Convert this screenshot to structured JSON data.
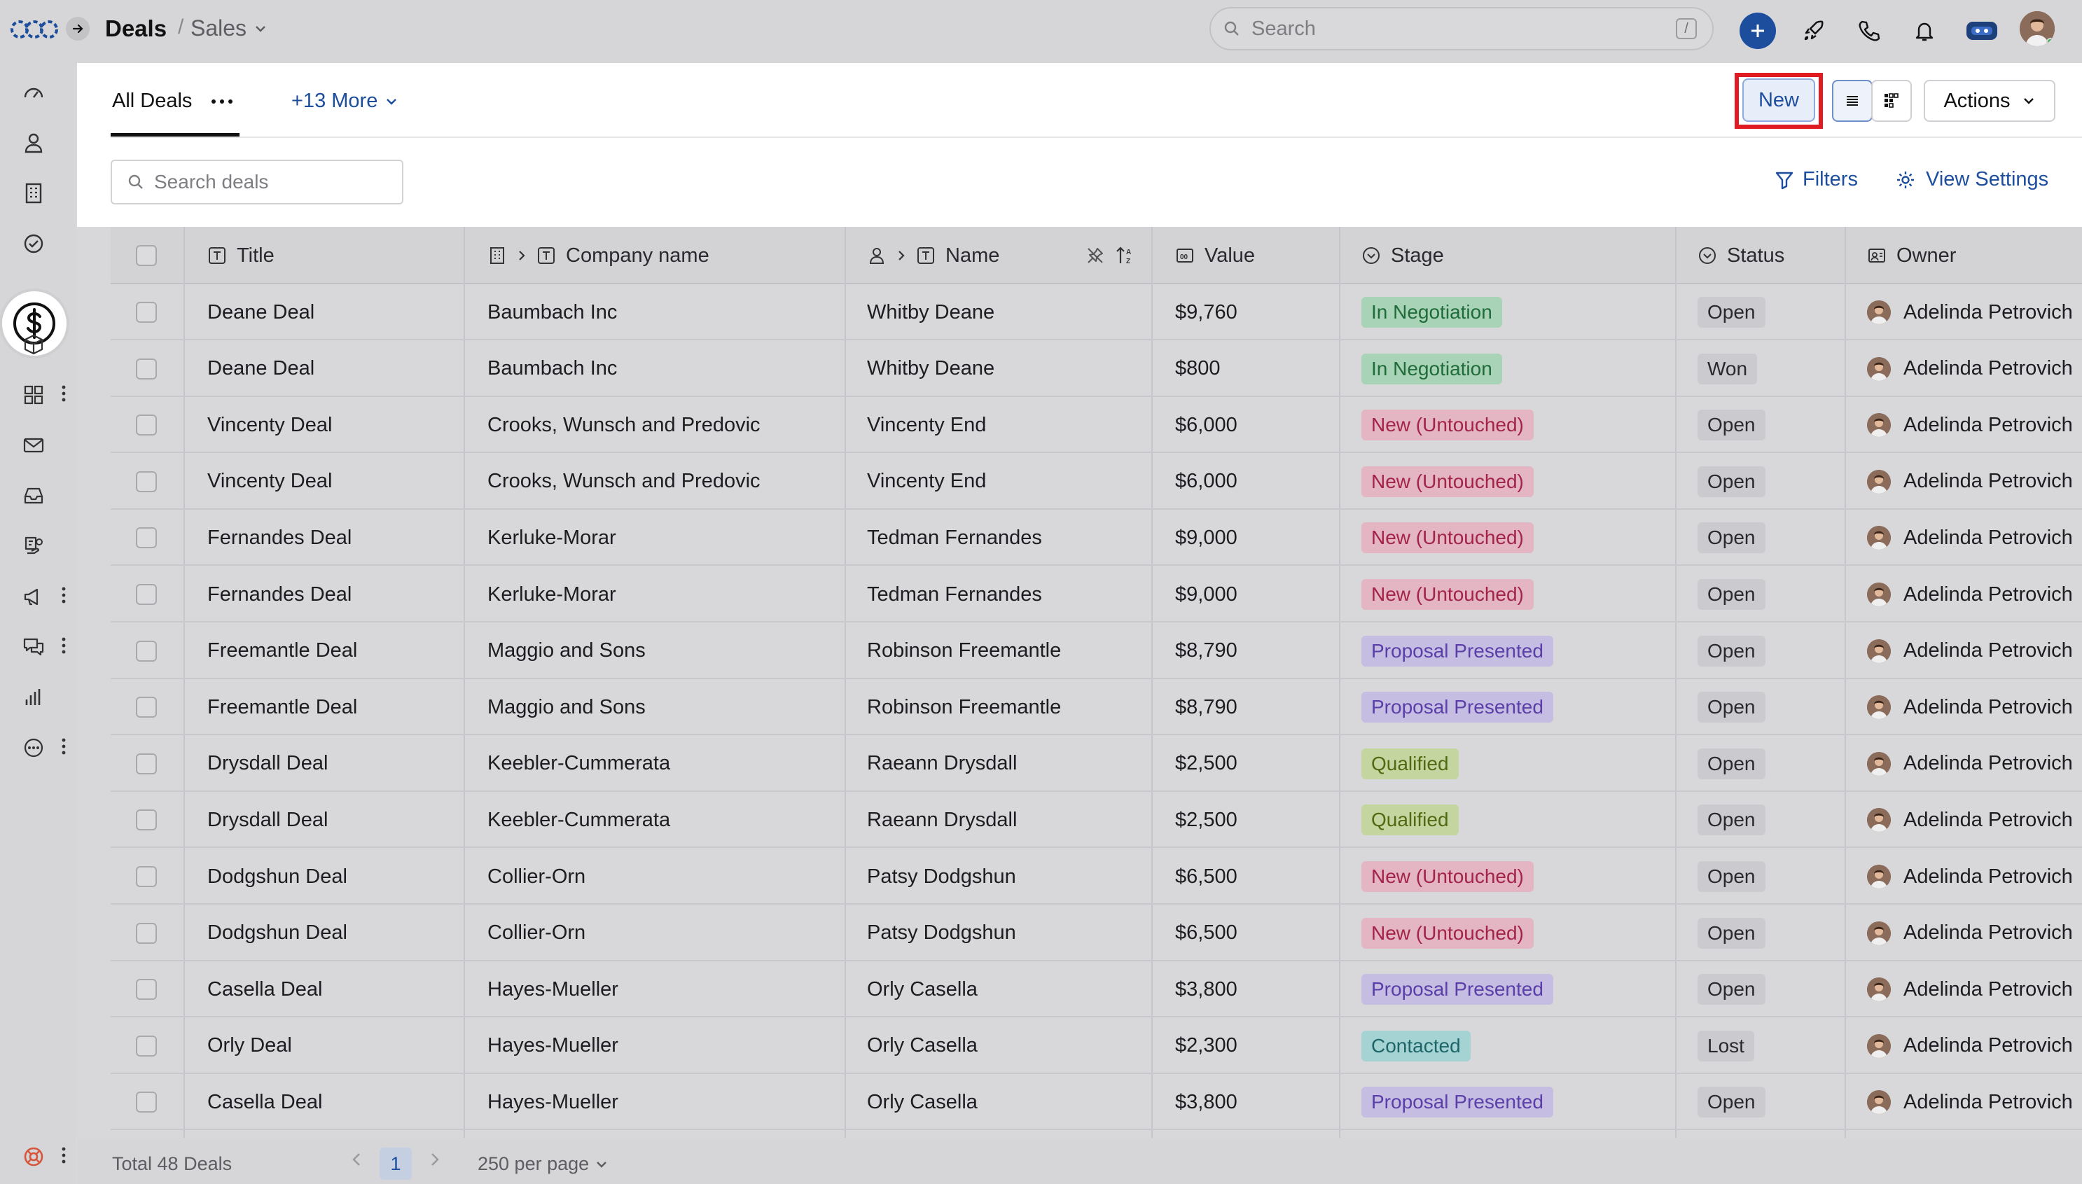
{
  "header": {
    "title": "Deals",
    "separator": "/",
    "subtitle": "Sales",
    "search_placeholder": "Search",
    "search_shortcut": "/"
  },
  "sidebar": {
    "items": [
      {
        "icon": "dashboard-icon"
      },
      {
        "icon": "person-icon"
      },
      {
        "icon": "building-icon"
      },
      {
        "icon": "check-circle-icon"
      },
      {
        "icon": "dollar-icon",
        "active": true
      },
      {
        "icon": "cube-icon"
      },
      {
        "icon": "apps-grid-icon"
      },
      {
        "icon": "mail-icon"
      },
      {
        "icon": "inbox-icon"
      },
      {
        "icon": "hand-coin-icon"
      },
      {
        "icon": "megaphone-icon"
      },
      {
        "icon": "chat-icon"
      },
      {
        "icon": "bar-chart-icon"
      },
      {
        "icon": "more-circle-icon"
      },
      {
        "icon": "help-buoy-icon"
      }
    ]
  },
  "tabs": {
    "active_label": "All Deals",
    "more_label": "+13 More"
  },
  "toolbar": {
    "new_label": "New",
    "actions_label": "Actions",
    "search_placeholder": "Search deals",
    "filters_label": "Filters",
    "view_settings_label": "View Settings"
  },
  "table": {
    "columns": {
      "title": "Title",
      "company": "Company name",
      "name": "Name",
      "value": "Value",
      "stage": "Stage",
      "status": "Status",
      "owner": "Owner"
    },
    "rows": [
      {
        "title": "Deane Deal",
        "company": "Baumbach Inc",
        "name": "Whitby Deane",
        "value": "$9,760",
        "stage": "In Negotiation",
        "status": "Open",
        "owner": "Adelinda Petrovich"
      },
      {
        "title": "Deane Deal",
        "company": "Baumbach Inc",
        "name": "Whitby Deane",
        "value": "$800",
        "stage": "In Negotiation",
        "status": "Won",
        "owner": "Adelinda Petrovich"
      },
      {
        "title": "Vincenty Deal",
        "company": "Crooks, Wunsch and Predovic",
        "name": "Vincenty End",
        "value": "$6,000",
        "stage": "New (Untouched)",
        "status": "Open",
        "owner": "Adelinda Petrovich"
      },
      {
        "title": "Vincenty Deal",
        "company": "Crooks, Wunsch and Predovic",
        "name": "Vincenty End",
        "value": "$6,000",
        "stage": "New (Untouched)",
        "status": "Open",
        "owner": "Adelinda Petrovich"
      },
      {
        "title": "Fernandes Deal",
        "company": "Kerluke-Morar",
        "name": "Tedman Fernandes",
        "value": "$9,000",
        "stage": "New (Untouched)",
        "status": "Open",
        "owner": "Adelinda Petrovich"
      },
      {
        "title": "Fernandes Deal",
        "company": "Kerluke-Morar",
        "name": "Tedman Fernandes",
        "value": "$9,000",
        "stage": "New (Untouched)",
        "status": "Open",
        "owner": "Adelinda Petrovich"
      },
      {
        "title": "Freemantle Deal",
        "company": "Maggio and Sons",
        "name": "Robinson Freemantle",
        "value": "$8,790",
        "stage": "Proposal Presented",
        "status": "Open",
        "owner": "Adelinda Petrovich"
      },
      {
        "title": "Freemantle Deal",
        "company": "Maggio and Sons",
        "name": "Robinson Freemantle",
        "value": "$8,790",
        "stage": "Proposal Presented",
        "status": "Open",
        "owner": "Adelinda Petrovich"
      },
      {
        "title": "Drysdall Deal",
        "company": "Keebler-Cummerata",
        "name": "Raeann Drysdall",
        "value": "$2,500",
        "stage": "Qualified",
        "status": "Open",
        "owner": "Adelinda Petrovich"
      },
      {
        "title": "Drysdall Deal",
        "company": "Keebler-Cummerata",
        "name": "Raeann Drysdall",
        "value": "$2,500",
        "stage": "Qualified",
        "status": "Open",
        "owner": "Adelinda Petrovich"
      },
      {
        "title": "Dodgshun Deal",
        "company": "Collier-Orn",
        "name": "Patsy Dodgshun",
        "value": "$6,500",
        "stage": "New (Untouched)",
        "status": "Open",
        "owner": "Adelinda Petrovich"
      },
      {
        "title": "Dodgshun Deal",
        "company": "Collier-Orn",
        "name": "Patsy Dodgshun",
        "value": "$6,500",
        "stage": "New (Untouched)",
        "status": "Open",
        "owner": "Adelinda Petrovich"
      },
      {
        "title": "Casella Deal",
        "company": "Hayes-Mueller",
        "name": "Orly Casella",
        "value": "$3,800",
        "stage": "Proposal Presented",
        "status": "Open",
        "owner": "Adelinda Petrovich"
      },
      {
        "title": "Orly Deal",
        "company": "Hayes-Mueller",
        "name": "Orly Casella",
        "value": "$2,300",
        "stage": "Contacted",
        "status": "Lost",
        "owner": "Adelinda Petrovich"
      },
      {
        "title": "Casella Deal",
        "company": "Hayes-Mueller",
        "name": "Orly Casella",
        "value": "$3,800",
        "stage": "Proposal Presented",
        "status": "Open",
        "owner": "Adelinda Petrovich"
      }
    ]
  },
  "stage_colors": {
    "In Negotiation": {
      "bg": "#a9d3b6",
      "fg": "#1f6b3a"
    },
    "New (Untouched)": {
      "bg": "#e4b6c3",
      "fg": "#a3234b"
    },
    "Proposal Presented": {
      "bg": "#c6bde3",
      "fg": "#5a3fa8"
    },
    "Qualified": {
      "bg": "#c5d59f",
      "fg": "#4f6a12"
    },
    "Contacted": {
      "bg": "#a5d3d4",
      "fg": "#1d6567"
    }
  },
  "footer": {
    "total": "Total 48 Deals",
    "page": "1",
    "per_page": "250 per page"
  },
  "colors": {
    "accent": "#1d4e9e",
    "highlight_frame": "#e11b22"
  }
}
